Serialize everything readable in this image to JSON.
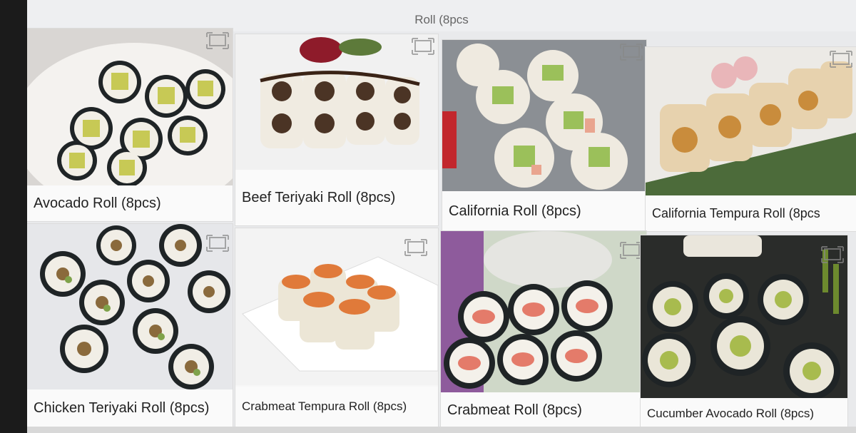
{
  "header": {
    "title": "Roll (8pcs"
  },
  "menu_items": [
    {
      "name": "Avocado Roll (8pcs)"
    },
    {
      "name": "Beef Teriyaki Roll (8pcs)"
    },
    {
      "name": "California Roll (8pcs)"
    },
    {
      "name": "California Tempura Roll (8pcs"
    },
    {
      "name": "Chicken Teriyaki Roll (8pcs)"
    },
    {
      "name": "Crabmeat Tempura Roll (8pcs)"
    },
    {
      "name": "Crabmeat Roll (8pcs)"
    },
    {
      "name": "Cucumber Avocado Roll (8pcs)"
    }
  ],
  "icons": {
    "expand": "expand-icon"
  },
  "colors": {
    "nori": "#1f2426",
    "rice": "#f2efe6",
    "avocado": "#b9c35a",
    "crab": "#e8907a"
  }
}
